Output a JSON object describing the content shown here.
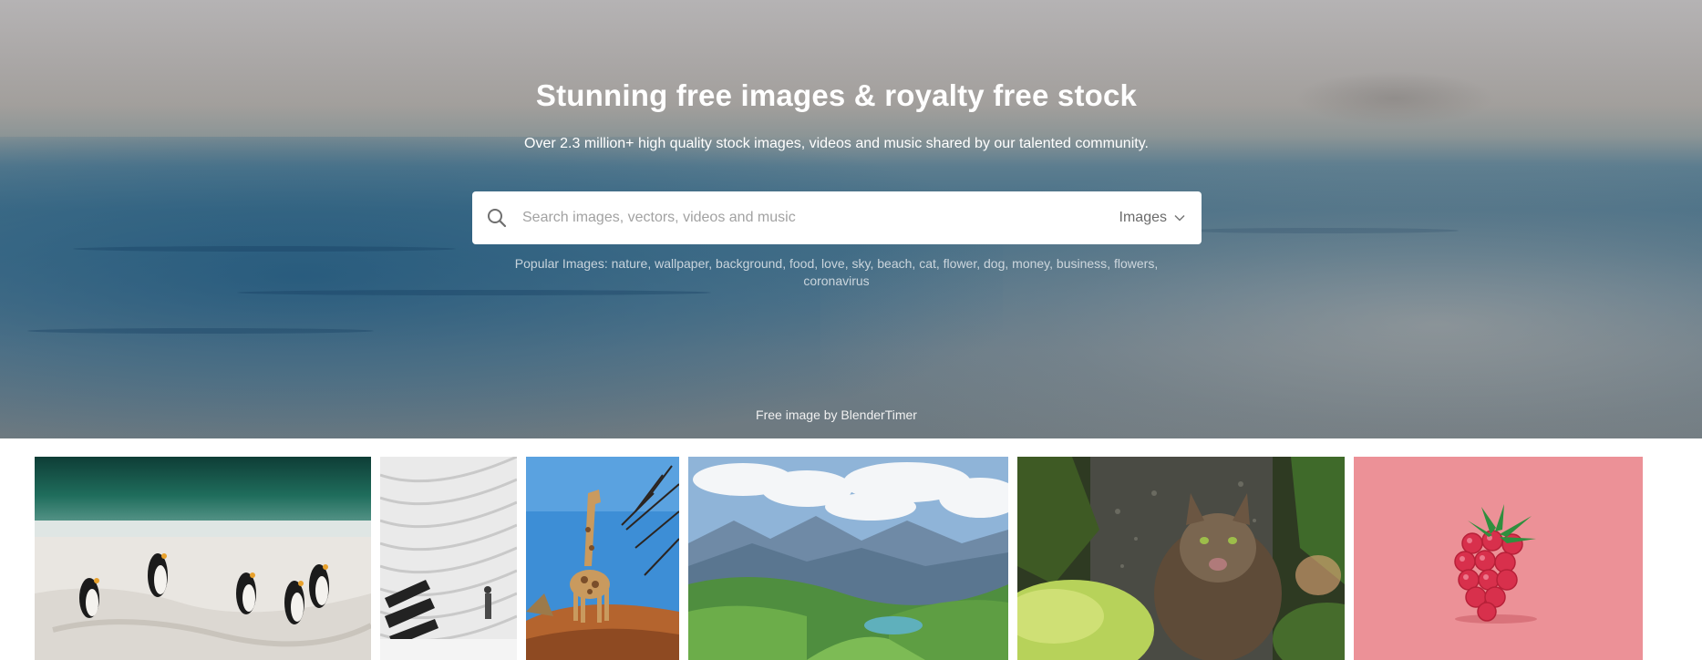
{
  "hero": {
    "title": "Stunning free images & royalty free stock",
    "subtitle": "Over 2.3 million+ high quality stock images, videos and music shared by our talented community.",
    "credit": "Free image by BlenderTimer"
  },
  "search": {
    "placeholder": "Search images, vectors, videos and music",
    "value": "",
    "type_selected": "Images",
    "icon": "search-icon"
  },
  "popular": {
    "prefix": "Popular Images:",
    "tags": [
      "nature",
      "wallpaper",
      "background",
      "food",
      "love",
      "sky",
      "beach",
      "cat",
      "flower",
      "dog",
      "money",
      "business",
      "flowers",
      "coronavirus"
    ]
  },
  "gallery": {
    "images": [
      {
        "subject": "penguins-on-beach"
      },
      {
        "subject": "white-architecture"
      },
      {
        "subject": "giraffe"
      },
      {
        "subject": "mountain-lake"
      },
      {
        "subject": "cat"
      },
      {
        "subject": "raspberry"
      }
    ]
  },
  "colors": {
    "search_bg": "#ffffff",
    "title_text": "#ffffff",
    "raspberry_bg": "#ec9197"
  }
}
